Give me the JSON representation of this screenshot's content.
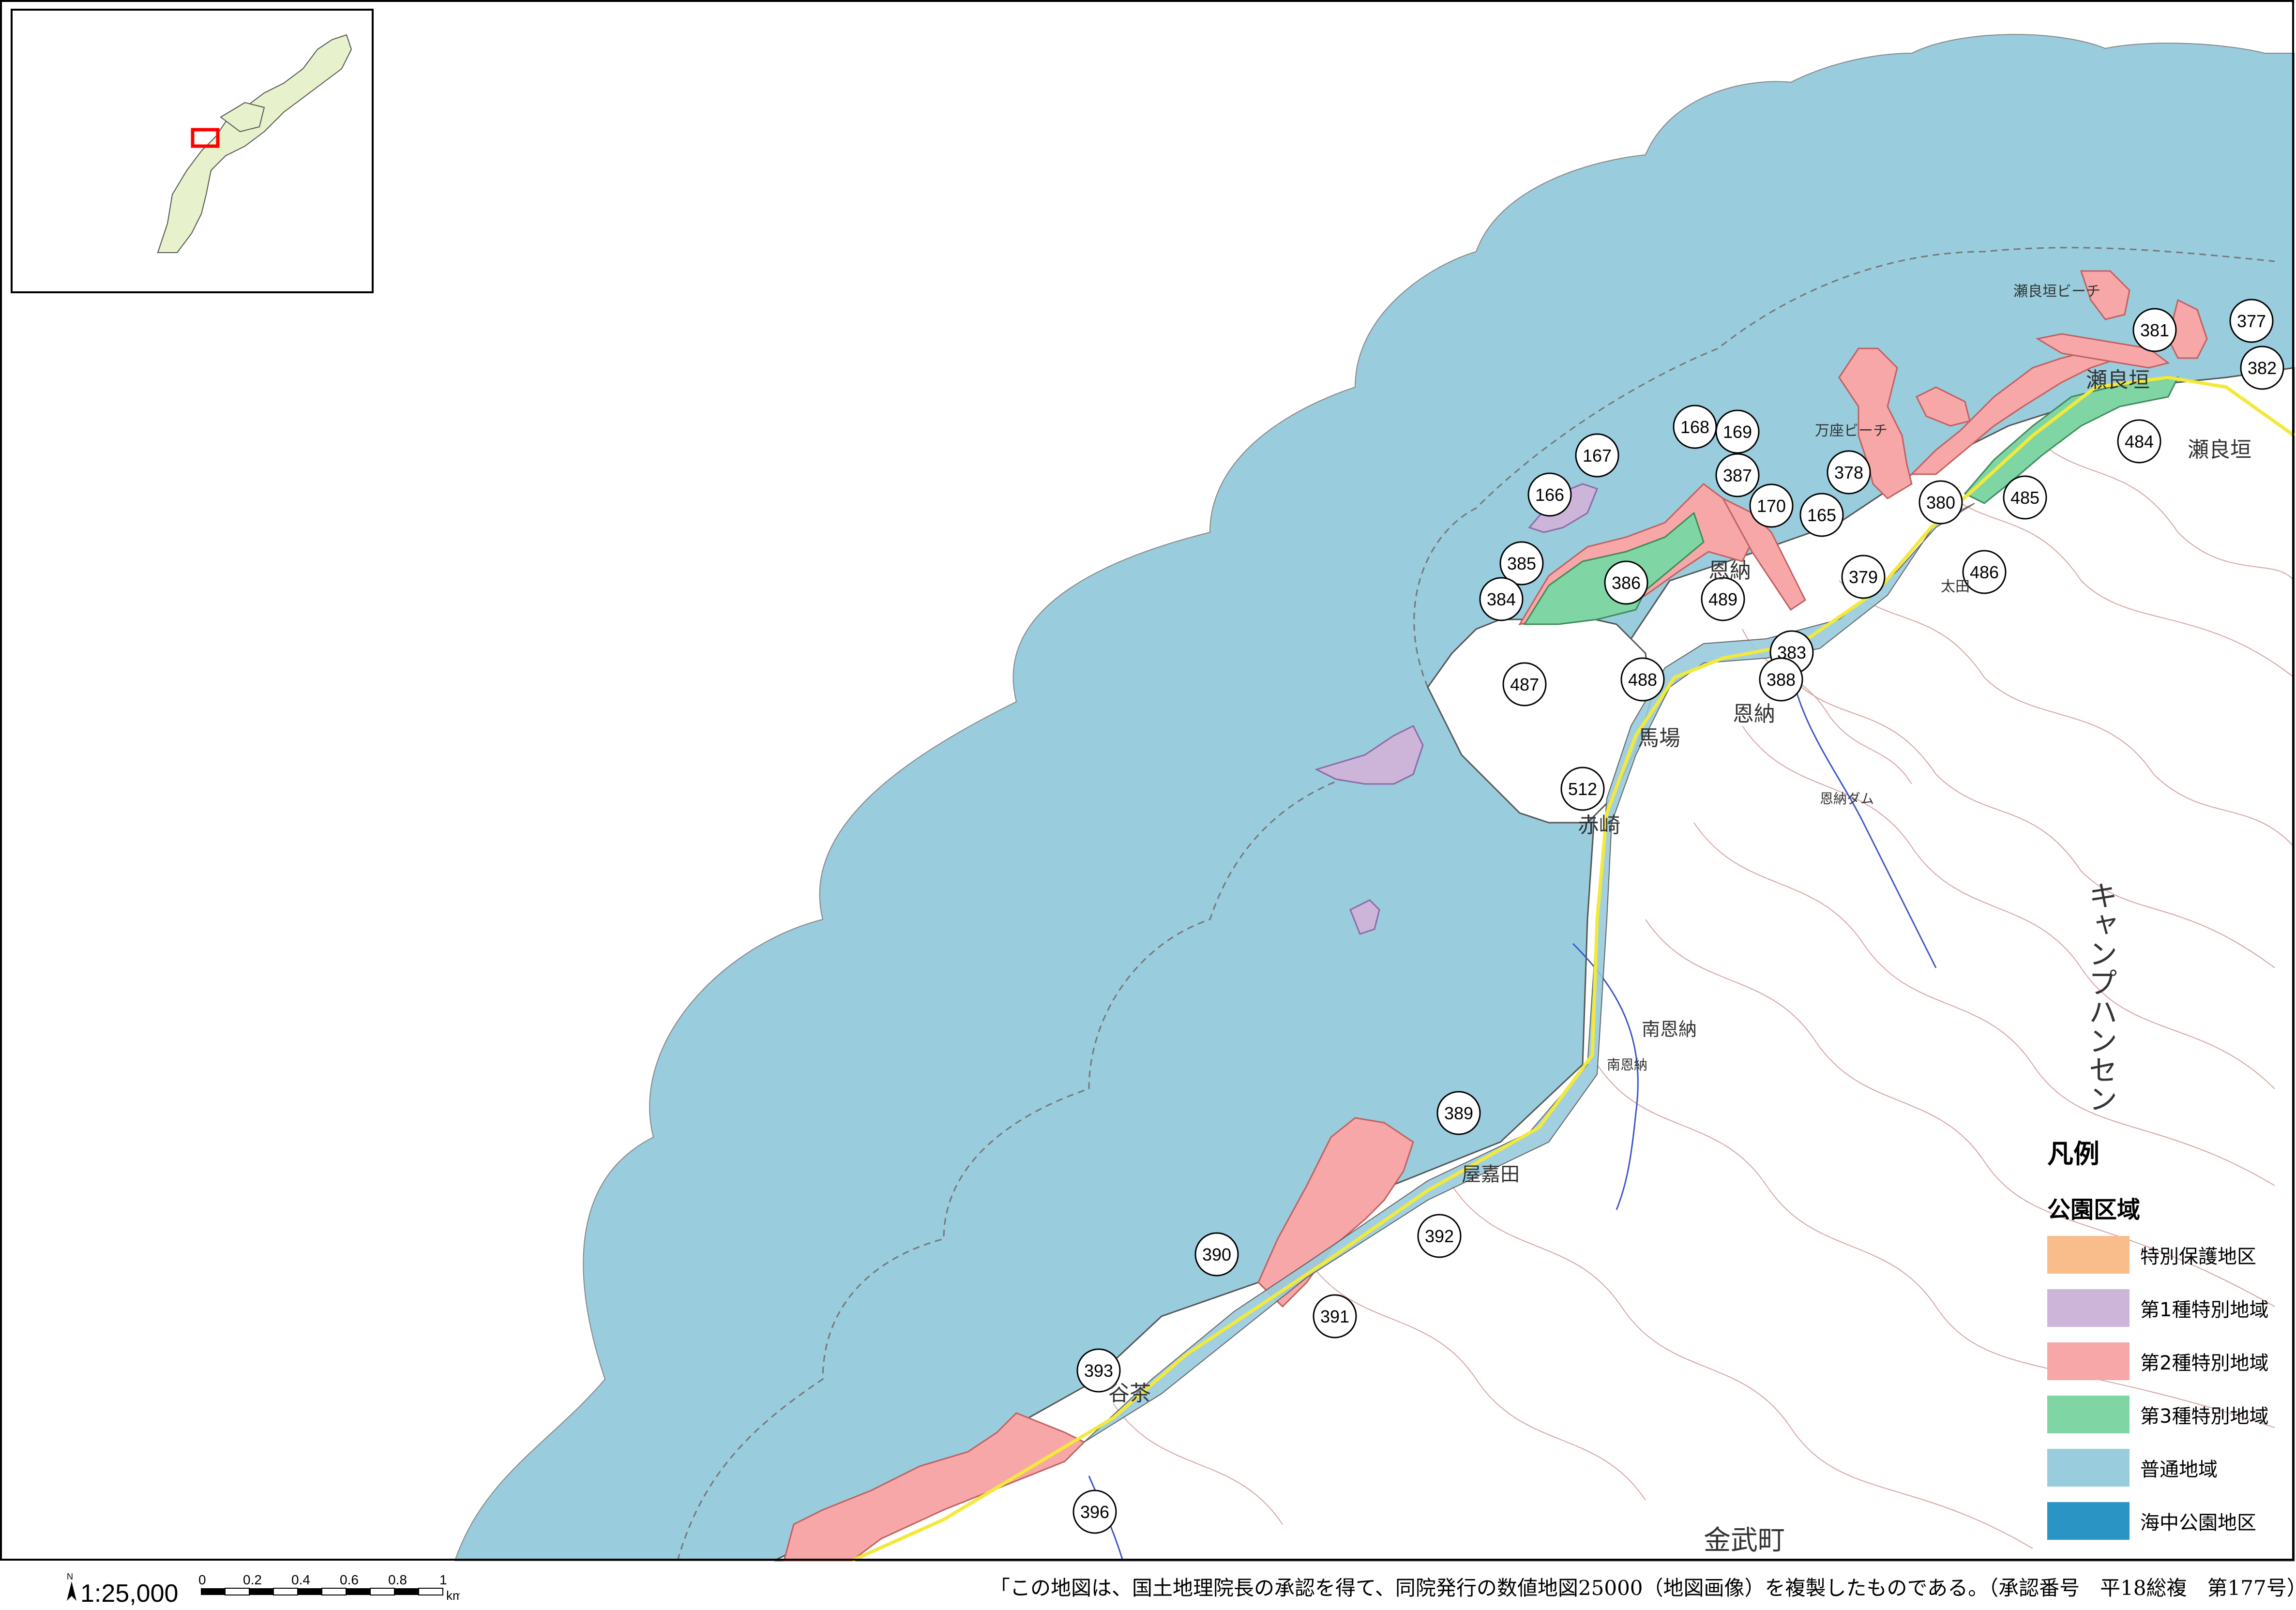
{
  "map": {
    "scale_label": "1:25,000",
    "north_label": "N",
    "scale_ticks": [
      "0",
      "0.2",
      "0.4",
      "0.6",
      "0.8",
      "1"
    ],
    "scale_unit": "km",
    "credit": "「この地図は、国土地理院長の承認を得て、同院発行の数値地図25000（地図画像）を複製したものである。（承認番号　平18総複　第177号）」"
  },
  "legend": {
    "title": "凡例",
    "subtitle": "公園区域",
    "items": [
      {
        "label": "特別保護地区",
        "color": "#f8bd8a"
      },
      {
        "label": "第1種特別地域",
        "color": "#cdb5da"
      },
      {
        "label": "第2種特別地域",
        "color": "#f7a7a7"
      },
      {
        "label": "第3種特別地域",
        "color": "#7fd5a4"
      },
      {
        "label": "普通地域",
        "color": "#99ccdd"
      },
      {
        "label": "海中公園地区",
        "color": "#2a95c4"
      }
    ]
  },
  "colors": {
    "sea": "#99ccdd",
    "land": "#ffffff",
    "inset_land": "#e7f2cc",
    "highlight_box": "#ff0000",
    "road": "#f2e93b",
    "contour": "#b9585b"
  },
  "place_labels": [
    "瀬良垣ビーチ",
    "万座ビーチ",
    "瀬良垣",
    "瀬良垣",
    "太田",
    "恩納",
    "恩納",
    "馬場",
    "赤崎",
    "南恩納",
    "屋嘉田",
    "谷茶",
    "キャンプハンセン",
    "金武町",
    "恩納ダム",
    "南恩納"
  ],
  "area_numbers": [
    "377",
    "381",
    "382",
    "484",
    "485",
    "486",
    "380",
    "378",
    "379",
    "165",
    "170",
    "387",
    "169",
    "168",
    "167",
    "166",
    "385",
    "384",
    "386",
    "489",
    "383",
    "388",
    "487",
    "488",
    "512",
    "389",
    "392",
    "390",
    "391",
    "393",
    "396"
  ]
}
